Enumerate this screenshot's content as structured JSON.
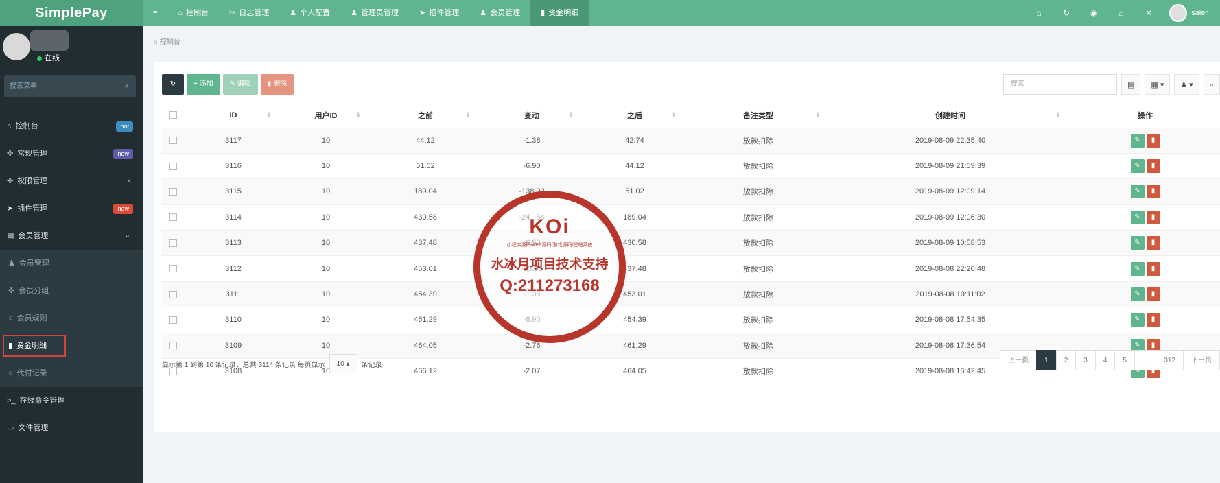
{
  "app": {
    "logo": "SimplePay"
  },
  "topnav": {
    "items": [
      {
        "icon": "≡",
        "label": ""
      },
      {
        "icon": "⌂",
        "label": "控制台"
      },
      {
        "icon": "✂",
        "label": "日志管理"
      },
      {
        "icon": "♟",
        "label": "个人配置"
      },
      {
        "icon": "♟",
        "label": "管理员管理"
      },
      {
        "icon": "➤",
        "label": "插件管理"
      },
      {
        "icon": "♟",
        "label": "会员管理"
      },
      {
        "icon": "▮",
        "label": "资金明细"
      }
    ],
    "right_icons": [
      "⌂",
      "↻",
      "◉",
      "⌂",
      "✕"
    ],
    "username": "saler"
  },
  "sidebar": {
    "status": "在线",
    "search_placeholder": "搜索菜单",
    "menu": [
      {
        "icon": "⌂",
        "label": "控制台",
        "badge": "hot",
        "badge_color": "#3c8dbc"
      },
      {
        "icon": "✣",
        "label": "常规管理",
        "badge": "new",
        "badge_color": "#605ca8"
      },
      {
        "icon": "✜",
        "label": "权限管理",
        "arrow": "‹"
      },
      {
        "icon": "➤",
        "label": "插件管理",
        "badge": "new",
        "badge_color": "#dd4b39"
      },
      {
        "icon": "▤",
        "label": "会员管理",
        "arrow": "⌄"
      }
    ],
    "submenu": [
      {
        "icon": "♟",
        "label": "会员管理"
      },
      {
        "icon": "✜",
        "label": "会员分组"
      },
      {
        "icon": "○",
        "label": "会员规则"
      },
      {
        "icon": "▮",
        "label": "资金明细"
      },
      {
        "icon": "○",
        "label": "代付记录"
      }
    ],
    "menu_after": [
      {
        "icon": ">_",
        "label": "在线命令管理"
      },
      {
        "icon": "▭",
        "label": "文件管理"
      }
    ]
  },
  "breadcrumb": {
    "icon": "⌂",
    "label": "控制台"
  },
  "toolbar": {
    "refresh": "↻",
    "add": "+ 添加",
    "edit": "✎ 编辑",
    "delete": "▮ 删除",
    "search_placeholder": "搜索",
    "t1": "▤",
    "t2": "▦ ▾",
    "t3": "♟ ▾",
    "t4": "⌕"
  },
  "table": {
    "columns": [
      "ID",
      "用户ID",
      "之前",
      "变动",
      "之后",
      "备注类型",
      "创建时间",
      "操作"
    ],
    "rows": [
      [
        "3117",
        "10",
        "44.12",
        "-1.38",
        "42.74",
        "放款扣除",
        "2019-08-09 22:35:40"
      ],
      [
        "3116",
        "10",
        "51.02",
        "-6.90",
        "44.12",
        "放款扣除",
        "2019-08-09 21:59:39"
      ],
      [
        "3115",
        "10",
        "189.04",
        "-138.02",
        "51.02",
        "放款扣除",
        "2019-08-09 12:09:14"
      ],
      [
        "3114",
        "10",
        "430.58",
        "-241.54",
        "189.04",
        "放款扣除",
        "2019-08-09 12:06:30"
      ],
      [
        "3113",
        "10",
        "437.48",
        "-6.90",
        "430.58",
        "放款扣除",
        "2019-08-09 10:58:53"
      ],
      [
        "3112",
        "10",
        "453.01",
        "-15.53",
        "437.48",
        "放款扣除",
        "2019-08-08 22:20:48"
      ],
      [
        "3111",
        "10",
        "454.39",
        "-1.38",
        "453.01",
        "放款扣除",
        "2019-08-08 19:11:02"
      ],
      [
        "3110",
        "10",
        "461.29",
        "-6.90",
        "454.39",
        "放款扣除",
        "2019-08-08 17:54:35"
      ],
      [
        "3109",
        "10",
        "464.05",
        "-2.76",
        "461.29",
        "放款扣除",
        "2019-08-08 17:36:54"
      ],
      [
        "3108",
        "10",
        "466.12",
        "-2.07",
        "464.05",
        "放款扣除",
        "2019-08-08 16:42:45"
      ]
    ],
    "edit_icon": "✎",
    "delete_icon": "▮"
  },
  "pagination": {
    "info_prefix": "显示第 1 到第 10 条记录，总共 3114 条记录 每页显示",
    "page_size": "10 ▴",
    "info_suffix": "条记录",
    "pages": [
      "上一页",
      "1",
      "2",
      "3",
      "4",
      "5",
      "...",
      "312",
      "下一页"
    ],
    "active": "1"
  },
  "watermark": {
    "brand": "KOi",
    "tagline": "小程序源码/APP源码/游戏源码/建站系统",
    "text": "水冰月项目技术支持",
    "qq": "Q:211273168"
  }
}
